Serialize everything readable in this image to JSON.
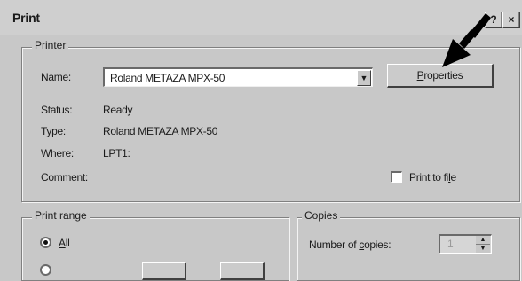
{
  "window": {
    "title": "Print",
    "help_label": "?",
    "close_label": "×"
  },
  "printer_group": {
    "legend": "Printer",
    "name_label": "Name:",
    "name_value": "Roland METAZA MPX-50",
    "properties_label": "Properties",
    "status_label": "Status:",
    "status_value": "Ready",
    "type_label": "Type:",
    "type_value": "Roland METAZA MPX-50",
    "where_label": "Where:",
    "where_value": "LPT1:",
    "comment_label": "Comment:",
    "print_to_file_label": "Print to file",
    "print_to_file_checked": false
  },
  "print_range_group": {
    "legend": "Print range",
    "all_label": "All",
    "all_selected": true
  },
  "copies_group": {
    "legend": "Copies",
    "number_label": "Number of copies:",
    "number_value": "1"
  },
  "annotation": {
    "arrow_color": "#000000"
  }
}
